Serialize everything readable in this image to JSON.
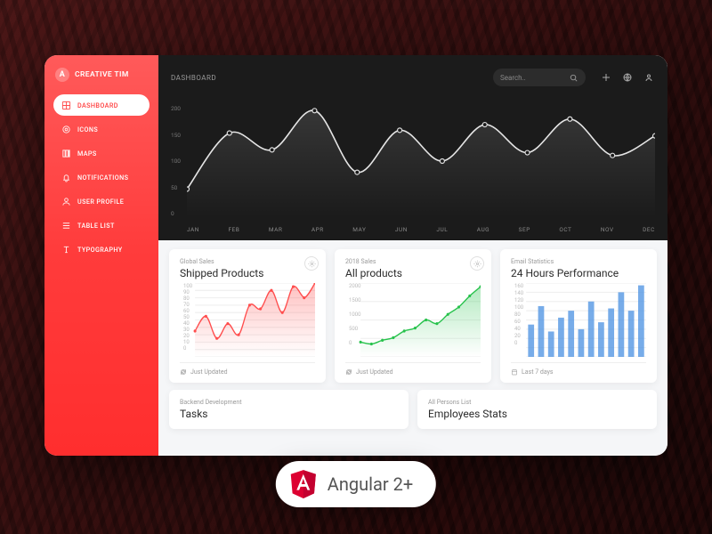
{
  "brand": {
    "initial": "A",
    "name": "CREATIVE TIM"
  },
  "breadcrumb": "DASHBOARD",
  "search": {
    "placeholder": "Search.."
  },
  "sidebar": {
    "items": [
      {
        "label": "DASHBOARD",
        "icon": "dashboard-icon",
        "active": true
      },
      {
        "label": "ICONS",
        "icon": "icons-icon"
      },
      {
        "label": "MAPS",
        "icon": "maps-icon"
      },
      {
        "label": "NOTIFICATIONS",
        "icon": "bell-icon"
      },
      {
        "label": "USER PROFILE",
        "icon": "user-icon"
      },
      {
        "label": "TABLE LIST",
        "icon": "list-icon"
      },
      {
        "label": "TYPOGRAPHY",
        "icon": "typography-icon"
      }
    ]
  },
  "chart_data": {
    "hero": {
      "type": "line",
      "categories": [
        "JAN",
        "FEB",
        "MAR",
        "APR",
        "MAY",
        "JUN",
        "JUL",
        "AUG",
        "SEP",
        "OCT",
        "NOV",
        "DEC"
      ],
      "y_ticks": [
        0,
        50,
        100,
        150,
        200
      ],
      "ylim": [
        0,
        200
      ],
      "values": [
        50,
        150,
        120,
        190,
        80,
        155,
        100,
        165,
        115,
        175,
        110,
        145
      ]
    },
    "shipped": {
      "type": "area",
      "color": "#ff4d4d",
      "y_ticks": [
        0,
        10,
        20,
        30,
        40,
        50,
        60,
        70,
        80,
        90,
        100
      ],
      "ylim": [
        0,
        100
      ],
      "values": [
        35,
        55,
        25,
        45,
        30,
        70,
        65,
        90,
        60,
        95,
        80,
        100
      ]
    },
    "all_products": {
      "type": "area",
      "color": "#27c24c",
      "y_ticks": [
        0,
        500,
        1000,
        1500,
        2000
      ],
      "ylim": [
        0,
        2000
      ],
      "values": [
        400,
        350,
        450,
        520,
        700,
        780,
        1000,
        900,
        1150,
        1350,
        1650,
        1900
      ]
    },
    "email": {
      "type": "bar",
      "color": "#4a90e2",
      "y_ticks": [
        0,
        20,
        40,
        60,
        80,
        100,
        120,
        140,
        160
      ],
      "ylim": [
        0,
        160
      ],
      "values": [
        70,
        110,
        55,
        85,
        100,
        60,
        120,
        75,
        105,
        140,
        100,
        155
      ]
    }
  },
  "cards": [
    {
      "eyebrow": "Global Sales",
      "title": "Shipped Products",
      "footer": "Just Updated",
      "footer_icon": "refresh-icon",
      "gear": true
    },
    {
      "eyebrow": "2018 Sales",
      "title": "All products",
      "footer": "Just Updated",
      "footer_icon": "refresh-icon",
      "gear": true
    },
    {
      "eyebrow": "Email Statistics",
      "title": "24 Hours Performance",
      "footer": "Last 7 days",
      "footer_icon": "calendar-icon",
      "gear": false
    }
  ],
  "row2": [
    {
      "eyebrow": "Backend Development",
      "title": "Tasks"
    },
    {
      "eyebrow": "All Persons List",
      "title": "Employees Stats"
    }
  ],
  "badge": {
    "text": "Angular 2+"
  }
}
